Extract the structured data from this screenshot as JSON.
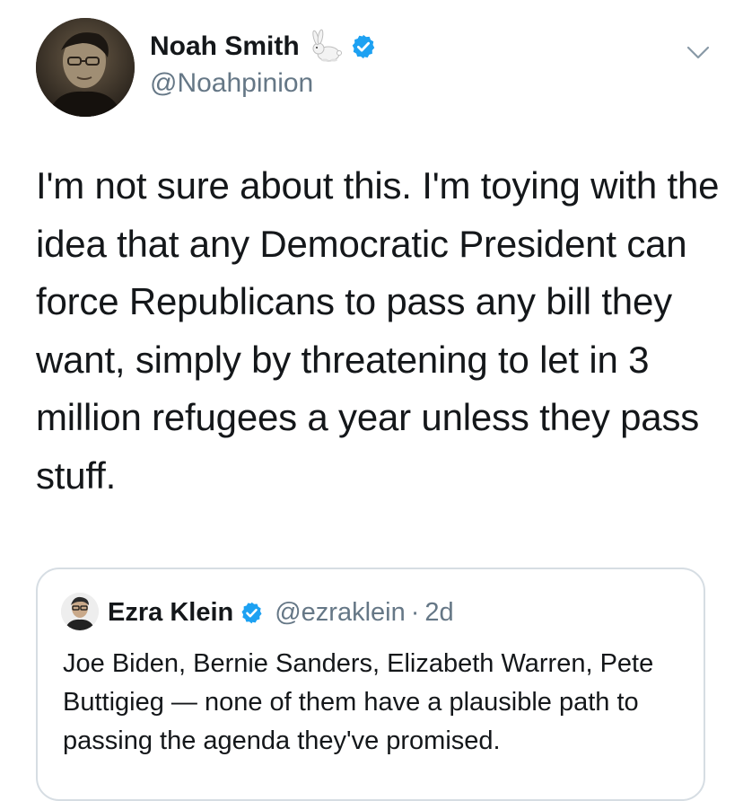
{
  "tweet": {
    "author_name": "Noah Smith",
    "author_emoji_icon": "rabbit-emoji",
    "verified_icon": "verified-badge-icon",
    "author_handle": "@Noahpinion",
    "menu_icon": "chevron-down-icon",
    "text": "I'm not sure about this. I'm toying with the idea that any Democratic President can force Republicans to pass any bill they want, simply by threatening to let in 3 million refugees a year unless they pass stuff."
  },
  "quoted_tweet": {
    "author_name": "Ezra Klein",
    "author_handle": "@ezraklein",
    "separator": "·",
    "time": "2d",
    "text": "Joe Biden, Bernie Sanders, Elizabeth Warren, Pete Buttigieg — none of them have a plausible path to passing the agenda they've promised."
  },
  "colors": {
    "text_primary": "#14171a",
    "text_secondary": "#657786",
    "verified_blue": "#1da1f2",
    "border": "#d6dde3"
  }
}
